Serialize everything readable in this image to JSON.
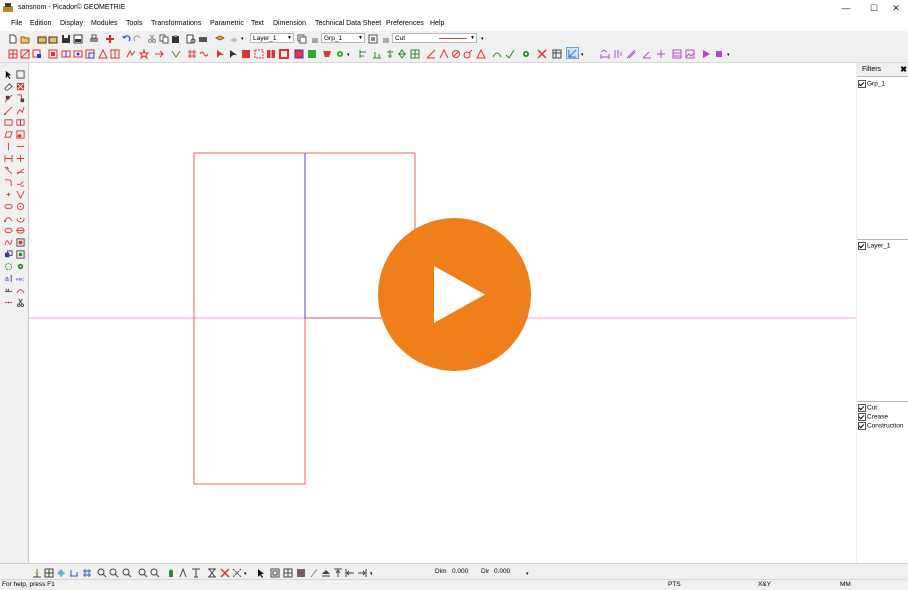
{
  "window": {
    "title": "sansnom - Picador© GEOMETRIE",
    "minimize_glyph": "—",
    "maximize_glyph": "☐",
    "close_glyph": "✕"
  },
  "menu": [
    "File",
    "Edition",
    "Display",
    "Modules",
    "Tools",
    "Transformations",
    "Parametric",
    "Text",
    "Dimension",
    "Technical Data Sheet",
    "Preferences",
    "Help"
  ],
  "toolbar": {
    "layer_combo": "Layer_1",
    "group_combo": "Grp_1",
    "linetype_combo": "Cut"
  },
  "filters": {
    "title": "Filters",
    "close_glyph": "✖",
    "groups": [
      "Grp_1"
    ],
    "layers": [
      "Layer_1"
    ],
    "line_types": [
      "Cut",
      "Crease",
      "Construction"
    ]
  },
  "bottom": {
    "dim_label": "Dim",
    "dim_value": "0.000",
    "dir_label": "Dir",
    "dir_value": "0.000"
  },
  "status": {
    "help_text": "For help, press F1",
    "units_pts": "PTS",
    "coord_mode": "X&Y",
    "units_mm": "MM"
  },
  "colors": {
    "cut_line": "#e2393f",
    "crease_line": "#3b3bd6",
    "construction_line": "#e78ae7",
    "play_button": "#ef7f1a"
  },
  "icons": {
    "play": "play-icon",
    "app": "picador-app-icon"
  }
}
